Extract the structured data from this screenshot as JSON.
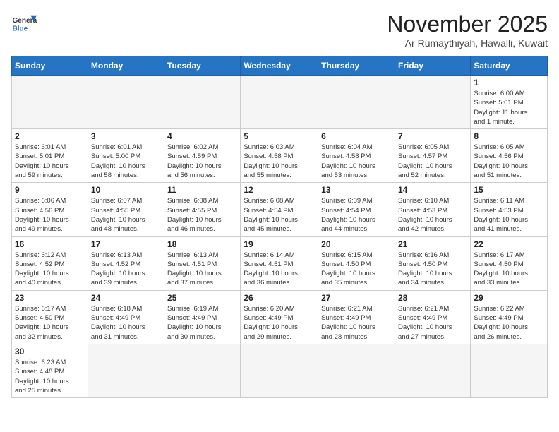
{
  "logo": {
    "text_general": "General",
    "text_blue": "Blue"
  },
  "title": "November 2025",
  "location": "Ar Rumaythiyah, Hawalli, Kuwait",
  "days_of_week": [
    "Sunday",
    "Monday",
    "Tuesday",
    "Wednesday",
    "Thursday",
    "Friday",
    "Saturday"
  ],
  "weeks": [
    [
      {
        "day": "",
        "info": ""
      },
      {
        "day": "",
        "info": ""
      },
      {
        "day": "",
        "info": ""
      },
      {
        "day": "",
        "info": ""
      },
      {
        "day": "",
        "info": ""
      },
      {
        "day": "",
        "info": ""
      },
      {
        "day": "1",
        "info": "Sunrise: 6:00 AM\nSunset: 5:01 PM\nDaylight: 11 hours\nand 1 minute."
      }
    ],
    [
      {
        "day": "2",
        "info": "Sunrise: 6:01 AM\nSunset: 5:01 PM\nDaylight: 10 hours\nand 59 minutes."
      },
      {
        "day": "3",
        "info": "Sunrise: 6:01 AM\nSunset: 5:00 PM\nDaylight: 10 hours\nand 58 minutes."
      },
      {
        "day": "4",
        "info": "Sunrise: 6:02 AM\nSunset: 4:59 PM\nDaylight: 10 hours\nand 56 minutes."
      },
      {
        "day": "5",
        "info": "Sunrise: 6:03 AM\nSunset: 4:58 PM\nDaylight: 10 hours\nand 55 minutes."
      },
      {
        "day": "6",
        "info": "Sunrise: 6:04 AM\nSunset: 4:58 PM\nDaylight: 10 hours\nand 53 minutes."
      },
      {
        "day": "7",
        "info": "Sunrise: 6:05 AM\nSunset: 4:57 PM\nDaylight: 10 hours\nand 52 minutes."
      },
      {
        "day": "8",
        "info": "Sunrise: 6:05 AM\nSunset: 4:56 PM\nDaylight: 10 hours\nand 51 minutes."
      }
    ],
    [
      {
        "day": "9",
        "info": "Sunrise: 6:06 AM\nSunset: 4:56 PM\nDaylight: 10 hours\nand 49 minutes."
      },
      {
        "day": "10",
        "info": "Sunrise: 6:07 AM\nSunset: 4:55 PM\nDaylight: 10 hours\nand 48 minutes."
      },
      {
        "day": "11",
        "info": "Sunrise: 6:08 AM\nSunset: 4:55 PM\nDaylight: 10 hours\nand 46 minutes."
      },
      {
        "day": "12",
        "info": "Sunrise: 6:08 AM\nSunset: 4:54 PM\nDaylight: 10 hours\nand 45 minutes."
      },
      {
        "day": "13",
        "info": "Sunrise: 6:09 AM\nSunset: 4:54 PM\nDaylight: 10 hours\nand 44 minutes."
      },
      {
        "day": "14",
        "info": "Sunrise: 6:10 AM\nSunset: 4:53 PM\nDaylight: 10 hours\nand 42 minutes."
      },
      {
        "day": "15",
        "info": "Sunrise: 6:11 AM\nSunset: 4:53 PM\nDaylight: 10 hours\nand 41 minutes."
      }
    ],
    [
      {
        "day": "16",
        "info": "Sunrise: 6:12 AM\nSunset: 4:52 PM\nDaylight: 10 hours\nand 40 minutes."
      },
      {
        "day": "17",
        "info": "Sunrise: 6:13 AM\nSunset: 4:52 PM\nDaylight: 10 hours\nand 39 minutes."
      },
      {
        "day": "18",
        "info": "Sunrise: 6:13 AM\nSunset: 4:51 PM\nDaylight: 10 hours\nand 37 minutes."
      },
      {
        "day": "19",
        "info": "Sunrise: 6:14 AM\nSunset: 4:51 PM\nDaylight: 10 hours\nand 36 minutes."
      },
      {
        "day": "20",
        "info": "Sunrise: 6:15 AM\nSunset: 4:50 PM\nDaylight: 10 hours\nand 35 minutes."
      },
      {
        "day": "21",
        "info": "Sunrise: 6:16 AM\nSunset: 4:50 PM\nDaylight: 10 hours\nand 34 minutes."
      },
      {
        "day": "22",
        "info": "Sunrise: 6:17 AM\nSunset: 4:50 PM\nDaylight: 10 hours\nand 33 minutes."
      }
    ],
    [
      {
        "day": "23",
        "info": "Sunrise: 6:17 AM\nSunset: 4:50 PM\nDaylight: 10 hours\nand 32 minutes."
      },
      {
        "day": "24",
        "info": "Sunrise: 6:18 AM\nSunset: 4:49 PM\nDaylight: 10 hours\nand 31 minutes."
      },
      {
        "day": "25",
        "info": "Sunrise: 6:19 AM\nSunset: 4:49 PM\nDaylight: 10 hours\nand 30 minutes."
      },
      {
        "day": "26",
        "info": "Sunrise: 6:20 AM\nSunset: 4:49 PM\nDaylight: 10 hours\nand 29 minutes."
      },
      {
        "day": "27",
        "info": "Sunrise: 6:21 AM\nSunset: 4:49 PM\nDaylight: 10 hours\nand 28 minutes."
      },
      {
        "day": "28",
        "info": "Sunrise: 6:21 AM\nSunset: 4:49 PM\nDaylight: 10 hours\nand 27 minutes."
      },
      {
        "day": "29",
        "info": "Sunrise: 6:22 AM\nSunset: 4:49 PM\nDaylight: 10 hours\nand 26 minutes."
      }
    ],
    [
      {
        "day": "30",
        "info": "Sunrise: 6:23 AM\nSunset: 4:48 PM\nDaylight: 10 hours\nand 25 minutes."
      },
      {
        "day": "",
        "info": ""
      },
      {
        "day": "",
        "info": ""
      },
      {
        "day": "",
        "info": ""
      },
      {
        "day": "",
        "info": ""
      },
      {
        "day": "",
        "info": ""
      },
      {
        "day": "",
        "info": ""
      }
    ]
  ]
}
